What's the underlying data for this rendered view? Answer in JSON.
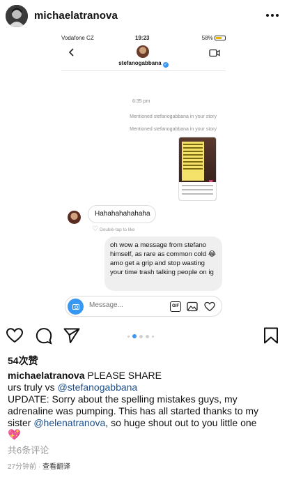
{
  "post": {
    "username": "michaelatranova",
    "likes": "54次赞",
    "caption_line1": "PLEASE SHARE",
    "caption_line2_prefix": "urs truly vs ",
    "caption_mention1": "@stefanogabbana",
    "caption_line3": "UPDATE: Sorry about the spelling mistakes guys, my adrenaline was pumping. This has all started thanks to my sister ",
    "caption_mention2": "@helenatranova",
    "caption_line3_suffix": ", so huge shout out to you little one",
    "view_comments": "共6条评论",
    "time_ago": "27分钟前",
    "separator": " · ",
    "translate": "查看翻译",
    "carousel": {
      "total": 5,
      "active": 2
    }
  },
  "embedded": {
    "status": {
      "carrier": "Vodafone CZ",
      "time": "19:23",
      "battery": "58%"
    },
    "thread_name": "stefanogabbana",
    "timestamp": "6:35 pm",
    "mention1": "Mentioned stefanogabbana in your story",
    "mention2": "Mentioned stefanogabbana in your story",
    "received_message": "Hahahahahahaha",
    "double_tap": "Double-tap to like",
    "sent_message": "oh wow a message from stefano himself, as rare as common cold 😂amo get a grip and stop wasting your time trash talking people on ig",
    "compose_placeholder": "Message...",
    "gif_label": "GIF"
  },
  "icons": {
    "more": "more-options-icon",
    "like": "heart-icon",
    "comment": "comment-icon",
    "share": "paper-plane-icon",
    "save": "bookmark-icon"
  },
  "colors": {
    "accent": "#3897f0",
    "mention": "#1b4e89",
    "muted": "#9a9a9a",
    "heart": "#e64a8c"
  }
}
